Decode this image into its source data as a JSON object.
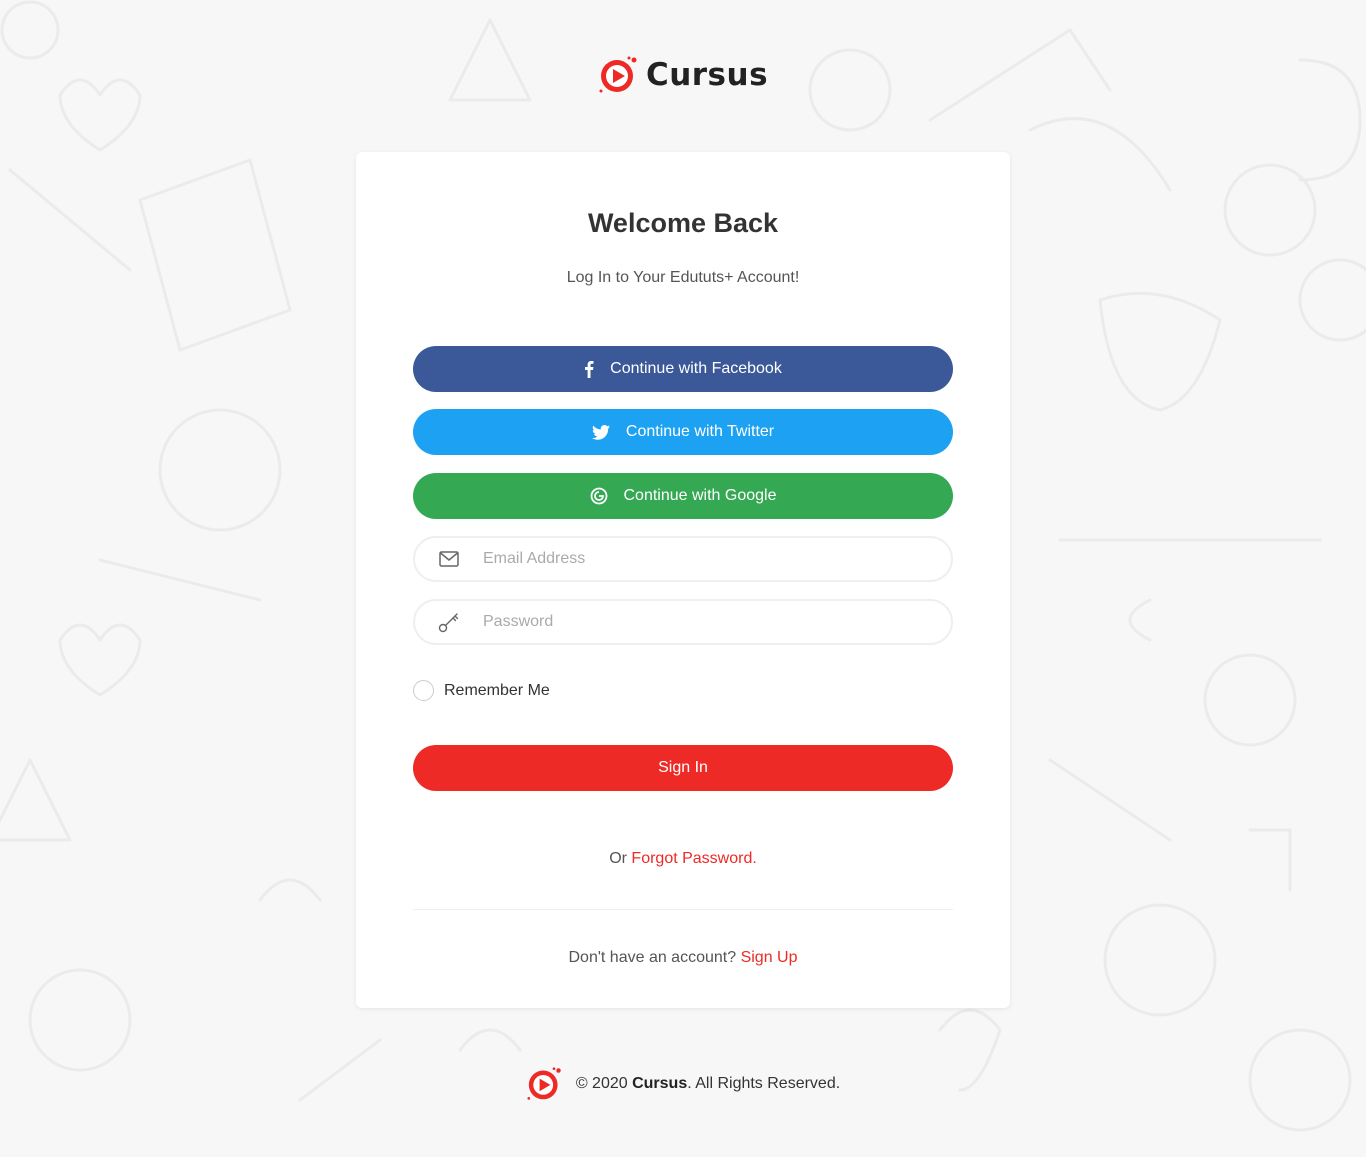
{
  "brand": {
    "name": "Cursus",
    "accent": "#ed2a26"
  },
  "login": {
    "title": "Welcome Back",
    "subtitle": "Log In to Your Edututs+ Account!",
    "social": {
      "facebook_label": "Continue with Facebook",
      "twitter_label": "Continue with Twitter",
      "google_label": "Continue with Google",
      "facebook_color": "#3b5998",
      "twitter_color": "#1da1f2",
      "google_color": "#34a853"
    },
    "email": {
      "placeholder": "Email Address",
      "value": "",
      "icon": "envelope-icon"
    },
    "password": {
      "placeholder": "Password",
      "value": "",
      "icon": "key-icon"
    },
    "remember_label": "Remember Me",
    "signin_label": "Sign In",
    "forgot_prefix": "Or",
    "forgot_link": "Forgot Password.",
    "signup_prefix": "Don't have an account?",
    "signup_link": "Sign Up"
  },
  "footer": {
    "copyright_prefix": "© 2020",
    "brand": "Cursus",
    "suffix": ". All Rights Reserved."
  }
}
